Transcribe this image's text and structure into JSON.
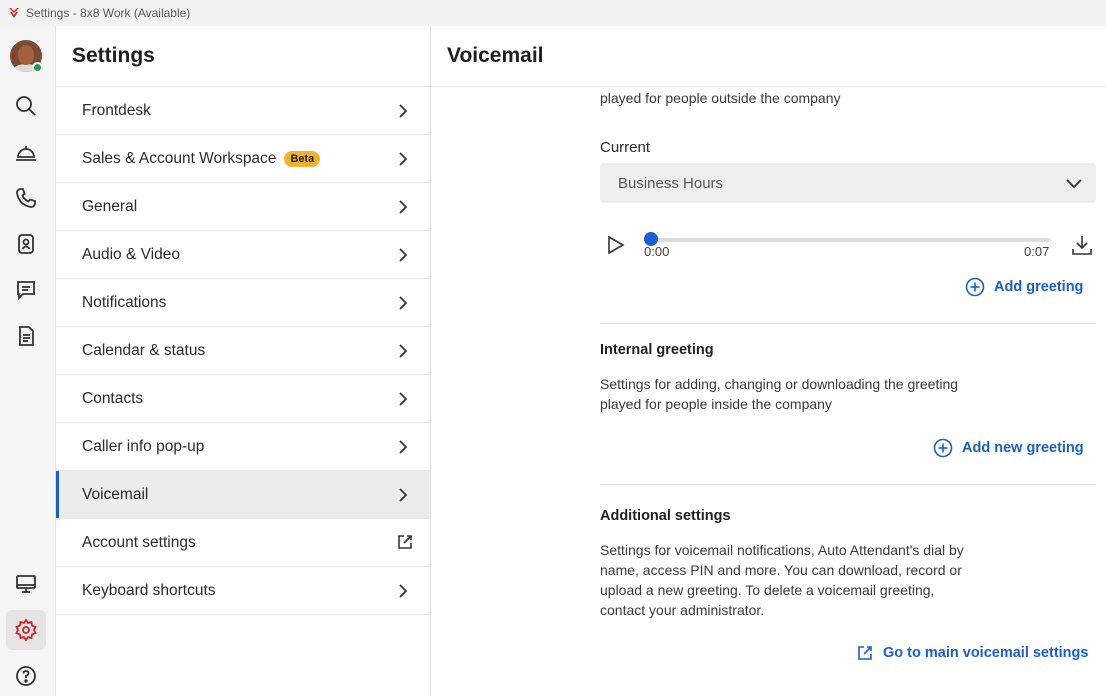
{
  "window": {
    "title": "Settings - 8x8 Work (Available)"
  },
  "rail": {
    "items": [
      {
        "name": "search-icon"
      },
      {
        "name": "frontdesk-bell-icon"
      },
      {
        "name": "phone-icon"
      },
      {
        "name": "contacts-icon"
      },
      {
        "name": "chat-icon"
      },
      {
        "name": "notes-icon"
      },
      {
        "name": "monitor-icon"
      },
      {
        "name": "gear-icon",
        "active": true
      },
      {
        "name": "help-icon"
      }
    ],
    "presence_color": "#21a04a"
  },
  "settings_panel": {
    "title": "Settings",
    "items": [
      {
        "label": "Frontdesk",
        "icon": "chevron-right-icon"
      },
      {
        "label": "Sales & Account Workspace",
        "badge": "Beta",
        "icon": "chevron-right-icon"
      },
      {
        "label": "General",
        "icon": "chevron-right-icon"
      },
      {
        "label": "Audio & Video",
        "icon": "chevron-right-icon"
      },
      {
        "label": "Notifications",
        "icon": "chevron-right-icon"
      },
      {
        "label": "Calendar & status",
        "icon": "chevron-right-icon"
      },
      {
        "label": "Contacts",
        "icon": "chevron-right-icon"
      },
      {
        "label": "Caller info pop-up",
        "icon": "chevron-right-icon"
      },
      {
        "label": "Voicemail",
        "icon": "chevron-right-icon",
        "active": true
      },
      {
        "label": "Account settings",
        "icon": "external-link-icon"
      },
      {
        "label": "Keyboard shortcuts",
        "icon": "chevron-right-icon"
      }
    ]
  },
  "voicemail": {
    "title": "Voicemail",
    "external_desc_tail": "played for people outside the company",
    "current_label": "Current",
    "current_value": "Business Hours",
    "player": {
      "elapsed": "0:00",
      "duration": "0:07",
      "progress": 0
    },
    "add_greeting": "Add greeting",
    "internal": {
      "heading": "Internal greeting",
      "desc_line1": "Settings for adding, changing or downloading the greeting",
      "desc_line2": "played for people inside the company",
      "add_new": "Add new greeting"
    },
    "additional": {
      "heading": "Additional settings",
      "desc_line1": "Settings for voicemail notifications, Auto Attendant's dial by",
      "desc_line2": "name, access PIN and more. You can download, record or",
      "desc_line3": "upload a new greeting. To delete a voicemail greeting,",
      "desc_line4": "contact your administrator.",
      "link": "Go to main voicemail settings"
    }
  },
  "colors": {
    "accent": "#1a5fcf",
    "beta_badge": "#f2b32a",
    "brand_red": "#d0202e"
  }
}
